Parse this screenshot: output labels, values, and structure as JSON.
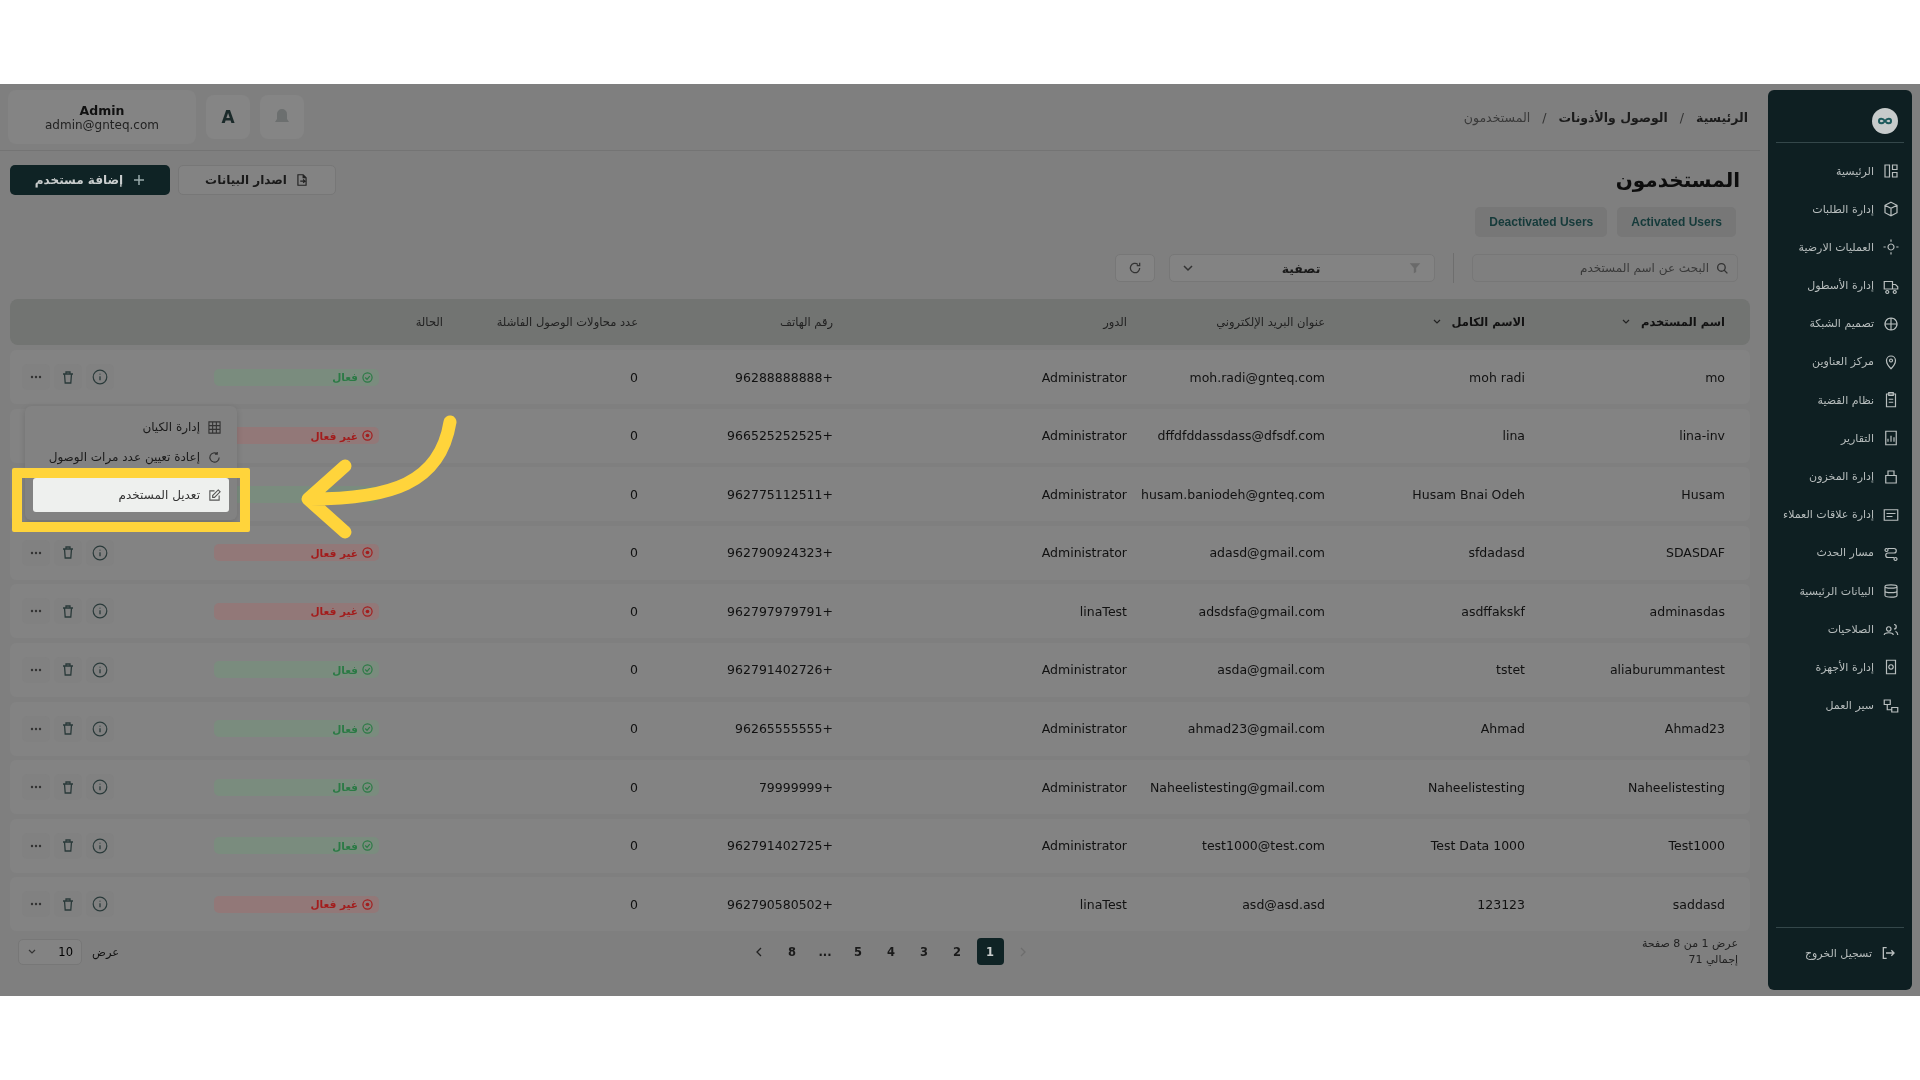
{
  "topbar": {
    "user": {
      "name": "Admin",
      "email": "admin@gnteq.com"
    },
    "language_button": "A"
  },
  "breadcrumb": [
    {
      "label": "الرئيسية",
      "current": false
    },
    {
      "separator": "/",
      "label": "الوصول والأذونات",
      "current": false
    },
    {
      "separator": "/",
      "label": "المستخدمون",
      "current": true
    }
  ],
  "page_title": "المستخدمون",
  "actions": {
    "add_button": "إضافة مستخدم",
    "export_button": "اصدار البيانات"
  },
  "tabs": [
    {
      "label": "Activated Users"
    },
    {
      "label": "Deactivated Users"
    }
  ],
  "search": {
    "placeholder": "البحث عن اسم المستخدم"
  },
  "filter": {
    "label": "تصفية"
  },
  "table": {
    "columns": [
      {
        "label": "اسم المستخدم",
        "sortable": true
      },
      {
        "label": "الاسم الكامل",
        "sortable": true
      },
      {
        "label": "عنوان البريد الإلكتروني",
        "sortable": false
      },
      {
        "label": "الدور",
        "sortable": false
      },
      {
        "label": "رقم الهاتف",
        "sortable": false
      },
      {
        "label": "عدد محاولات الوصول الفاشلة",
        "sortable": false
      },
      {
        "label": "الحالة",
        "sortable": false
      }
    ],
    "rows": [
      {
        "username": "mo",
        "full_name": "moh radi",
        "email": "moh.radi@gnteq.com",
        "role": "Administrator",
        "phone": "96288888888+",
        "failed_attempts": "0",
        "status": {
          "label": "فعال",
          "active": true
        }
      },
      {
        "username": "lina-inv",
        "full_name": "lina",
        "email": "dffdfddassdass@dfsdf.com",
        "role": "Administrator",
        "phone": "966525252525+",
        "failed_attempts": "0",
        "status": {
          "label": "غير فعال",
          "active": false
        }
      },
      {
        "username": "Husam",
        "full_name": "Husam Bnai Odeh",
        "email": "husam.baniodeh@gnteq.com",
        "role": "Administrator",
        "phone": "962775112511+",
        "failed_attempts": "0",
        "status": {
          "active": true
        }
      },
      {
        "username": "SDASDAF",
        "full_name": "sfdadasd",
        "email": "adasd@gmail.com",
        "role": "Administrator",
        "phone": "962790924323+",
        "failed_attempts": "0",
        "status": {
          "label": "غير فعال",
          "active": false
        }
      },
      {
        "username": "adminasdas",
        "full_name": "asdffakskf",
        "email": "adsdsfa@gmail.com",
        "role": "linaTest",
        "phone": "962797979791+",
        "failed_attempts": "0",
        "status": {
          "label": "غير فعال",
          "active": false
        }
      },
      {
        "username": "aliaburummantest",
        "full_name": "tstet",
        "email": "asda@gmail.com",
        "role": "Administrator",
        "phone": "962791402726+",
        "failed_attempts": "0",
        "status": {
          "label": "فعال",
          "active": true
        }
      },
      {
        "username": "Ahmad23",
        "full_name": "Ahmad",
        "email": "ahmad23@gmail.com",
        "role": "Administrator",
        "phone": "96265555555+",
        "failed_attempts": "0",
        "status": {
          "label": "فعال",
          "active": true
        }
      },
      {
        "username": "Naheelistesting",
        "full_name": "Naheelistesting",
        "email": "Naheelistesting@gmail.com",
        "role": "Administrator",
        "phone": "79999999+",
        "failed_attempts": "0",
        "status": {
          "label": "فعال",
          "active": true
        }
      },
      {
        "username": "Test1000",
        "full_name": "Test Data 1000",
        "email": "test1000@test.com",
        "role": "Administrator",
        "phone": "962791402725+",
        "failed_attempts": "0",
        "status": {
          "label": "فعال",
          "active": true
        }
      },
      {
        "username": "saddasd",
        "full_name": "123123",
        "email": "asd@asd.asd",
        "role": "linaTest",
        "phone": "962790580502+",
        "failed_attempts": "0",
        "status": {
          "label": "غير فعال",
          "active": false
        }
      }
    ]
  },
  "context_menu": [
    {
      "label": "إدارة الكيان",
      "selected": false
    },
    {
      "label": "إعادة تعيين عدد مرات الوصول",
      "selected": false
    },
    {
      "label": "تعديل المستخدم",
      "selected": true
    }
  ],
  "pagination": {
    "summary": "عرض 1 من 8 صفحة",
    "total": "إجمالي 71",
    "pages": [
      {
        "label": "1",
        "selected": true
      },
      {
        "label": "2",
        "selected": false
      },
      {
        "label": "3",
        "selected": false
      },
      {
        "label": "4",
        "selected": false
      },
      {
        "label": "5",
        "selected": false
      },
      {
        "label": "...",
        "selected": false
      },
      {
        "label": "8",
        "selected": false
      }
    ],
    "page_size_label": "عرض",
    "page_size": "10"
  },
  "sidebar": {
    "items": [
      {
        "label": "الرئيسية"
      },
      {
        "label": "إدارة الطلبات"
      },
      {
        "label": "العمليات الارضية"
      },
      {
        "label": "إدارة الأسطول"
      },
      {
        "label": "تصميم الشبكة"
      },
      {
        "label": "مركز العناوين"
      },
      {
        "label": "نظام القضية"
      },
      {
        "label": "التقارير"
      },
      {
        "label": "إدارة المخزون"
      },
      {
        "label": "إدارة علاقات العملاء"
      },
      {
        "label": "مسار الحدث"
      },
      {
        "label": "البيانات الرئيسية"
      },
      {
        "label": "الصلاحيات"
      },
      {
        "label": "إدارة الأجهزة"
      },
      {
        "label": "سير العمل"
      }
    ],
    "logout": "تسجيل الخروج"
  }
}
